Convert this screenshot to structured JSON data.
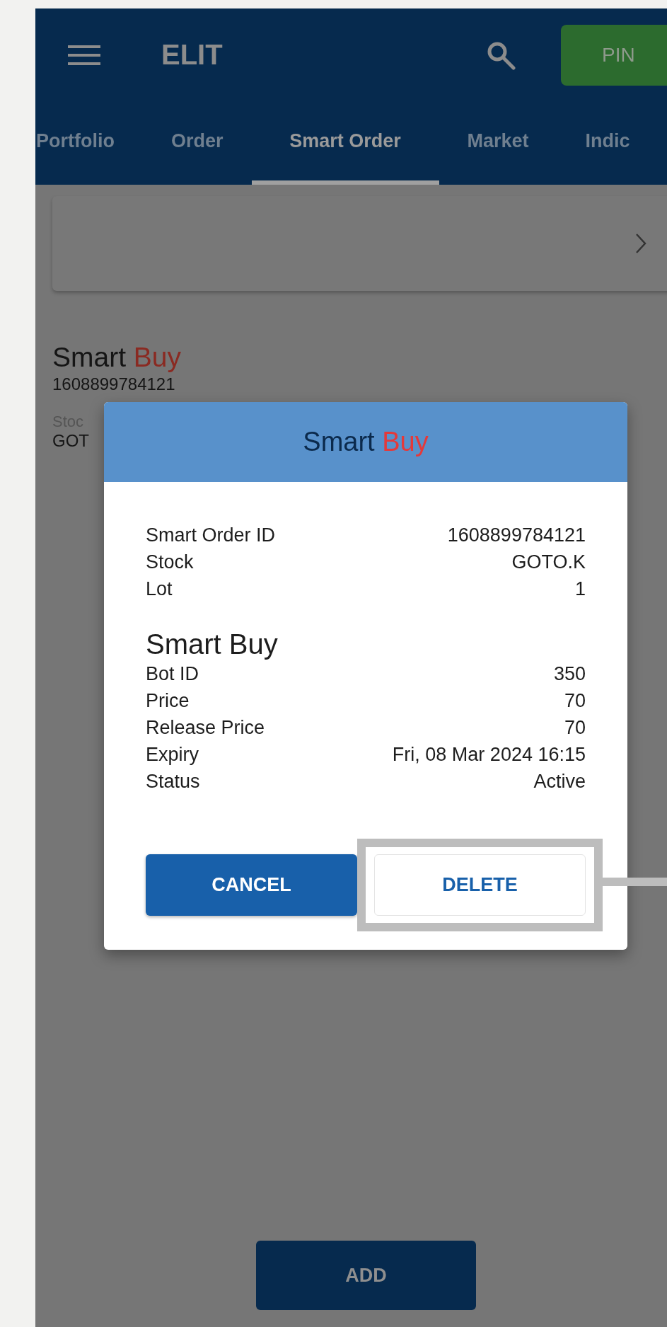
{
  "app_bar": {
    "title": "ELIT",
    "pin_button": "PIN"
  },
  "tabs": [
    {
      "label": "Portfolio",
      "selected": false
    },
    {
      "label": "Order",
      "selected": false
    },
    {
      "label": "Smart Order",
      "selected": true
    },
    {
      "label": "Market",
      "selected": false
    },
    {
      "label": "Indic",
      "selected": false
    }
  ],
  "order": {
    "title": "Smart",
    "side": "Buy",
    "id": "1608899784121",
    "field_label": "Stoc",
    "field_value": "GOT"
  },
  "dialog": {
    "title": "Smart",
    "side": "Buy",
    "summary": [
      {
        "label": "Smart Order ID",
        "value": "1608899784121"
      },
      {
        "label": "Stock",
        "value": "GOTO.K"
      },
      {
        "label": "Lot",
        "value": "1"
      }
    ],
    "section_title": "Smart Buy",
    "details": [
      {
        "label": "Bot ID",
        "value": "350"
      },
      {
        "label": "Price",
        "value": "70"
      },
      {
        "label": "Release Price",
        "value": "70"
      },
      {
        "label": "Expiry",
        "value": "Fri, 08 Mar 2024 16:15"
      },
      {
        "label": "Status",
        "value": "Active"
      }
    ],
    "buttons": [
      {
        "label": "CANCEL",
        "kind": "primary",
        "highlighted": false
      },
      {
        "label": "DELETE",
        "kind": "secondary",
        "highlighted": true
      }
    ]
  },
  "add_button": "ADD"
}
